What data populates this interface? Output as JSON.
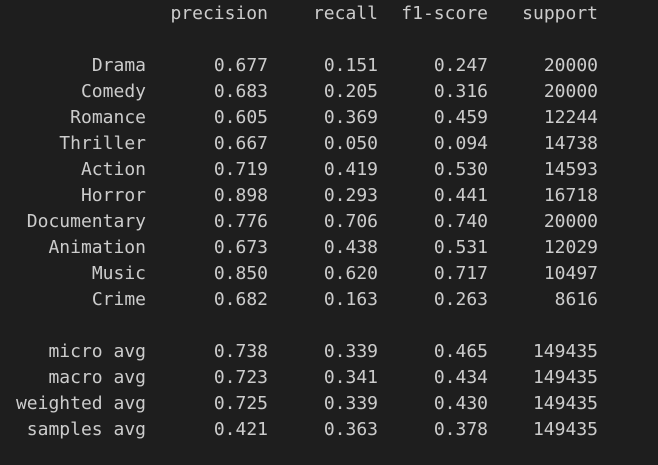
{
  "report": {
    "headers": {
      "precision": "precision",
      "recall": "recall",
      "f1": "f1-score",
      "support": "support"
    },
    "classes": [
      {
        "label": "Drama",
        "precision": "0.677",
        "recall": "0.151",
        "f1": "0.247",
        "support": "20000"
      },
      {
        "label": "Comedy",
        "precision": "0.683",
        "recall": "0.205",
        "f1": "0.316",
        "support": "20000"
      },
      {
        "label": "Romance",
        "precision": "0.605",
        "recall": "0.369",
        "f1": "0.459",
        "support": "12244"
      },
      {
        "label": "Thriller",
        "precision": "0.667",
        "recall": "0.050",
        "f1": "0.094",
        "support": "14738"
      },
      {
        "label": "Action",
        "precision": "0.719",
        "recall": "0.419",
        "f1": "0.530",
        "support": "14593"
      },
      {
        "label": "Horror",
        "precision": "0.898",
        "recall": "0.293",
        "f1": "0.441",
        "support": "16718"
      },
      {
        "label": "Documentary",
        "precision": "0.776",
        "recall": "0.706",
        "f1": "0.740",
        "support": "20000"
      },
      {
        "label": "Animation",
        "precision": "0.673",
        "recall": "0.438",
        "f1": "0.531",
        "support": "12029"
      },
      {
        "label": "Music",
        "precision": "0.850",
        "recall": "0.620",
        "f1": "0.717",
        "support": "10497"
      },
      {
        "label": "Crime",
        "precision": "0.682",
        "recall": "0.163",
        "f1": "0.263",
        "support": "8616"
      }
    ],
    "averages": [
      {
        "label": "micro avg",
        "precision": "0.738",
        "recall": "0.339",
        "f1": "0.465",
        "support": "149435"
      },
      {
        "label": "macro avg",
        "precision": "0.723",
        "recall": "0.341",
        "f1": "0.434",
        "support": "149435"
      },
      {
        "label": "weighted avg",
        "precision": "0.725",
        "recall": "0.339",
        "f1": "0.430",
        "support": "149435"
      },
      {
        "label": "samples avg",
        "precision": "0.421",
        "recall": "0.363",
        "f1": "0.378",
        "support": "149435"
      }
    ]
  },
  "theme": {
    "background": "#1e1e1e",
    "text": "#cccccc"
  }
}
